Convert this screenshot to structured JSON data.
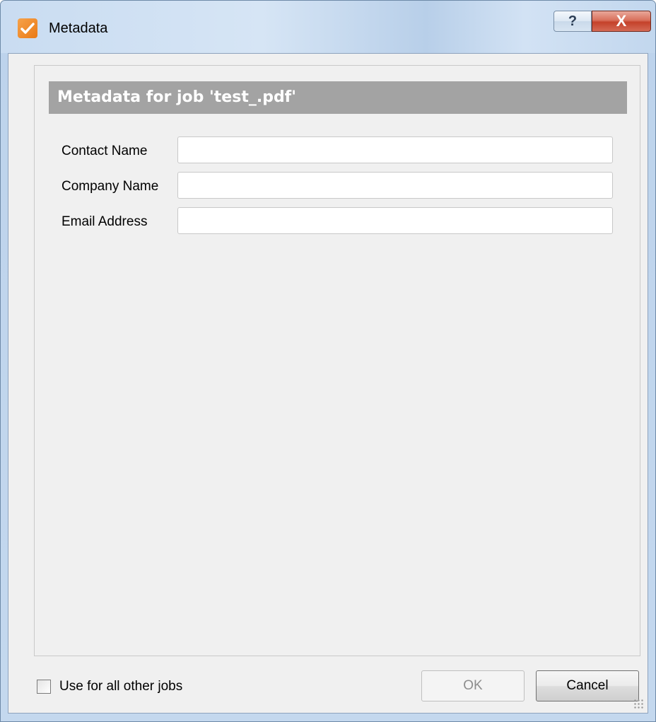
{
  "window": {
    "title": "Metadata",
    "help_glyph": "?",
    "close_glyph": "X"
  },
  "panel": {
    "header": "Metadata for job 'test_.pdf'"
  },
  "fields": [
    {
      "label": "Contact Name",
      "value": ""
    },
    {
      "label": "Company Name",
      "value": ""
    },
    {
      "label": "Email Address",
      "value": ""
    }
  ],
  "footer": {
    "checkbox_label": "Use for all other jobs",
    "checkbox_checked": false,
    "ok_label": "OK",
    "cancel_label": "Cancel"
  },
  "colors": {
    "header_bg": "#a3a3a3",
    "app_icon": "#ea7a16",
    "close_button": "#c4412a"
  },
  "icons": {
    "app": "app-logo-icon",
    "help": "help-icon",
    "close": "close-icon",
    "resize": "resize-grip-icon"
  }
}
